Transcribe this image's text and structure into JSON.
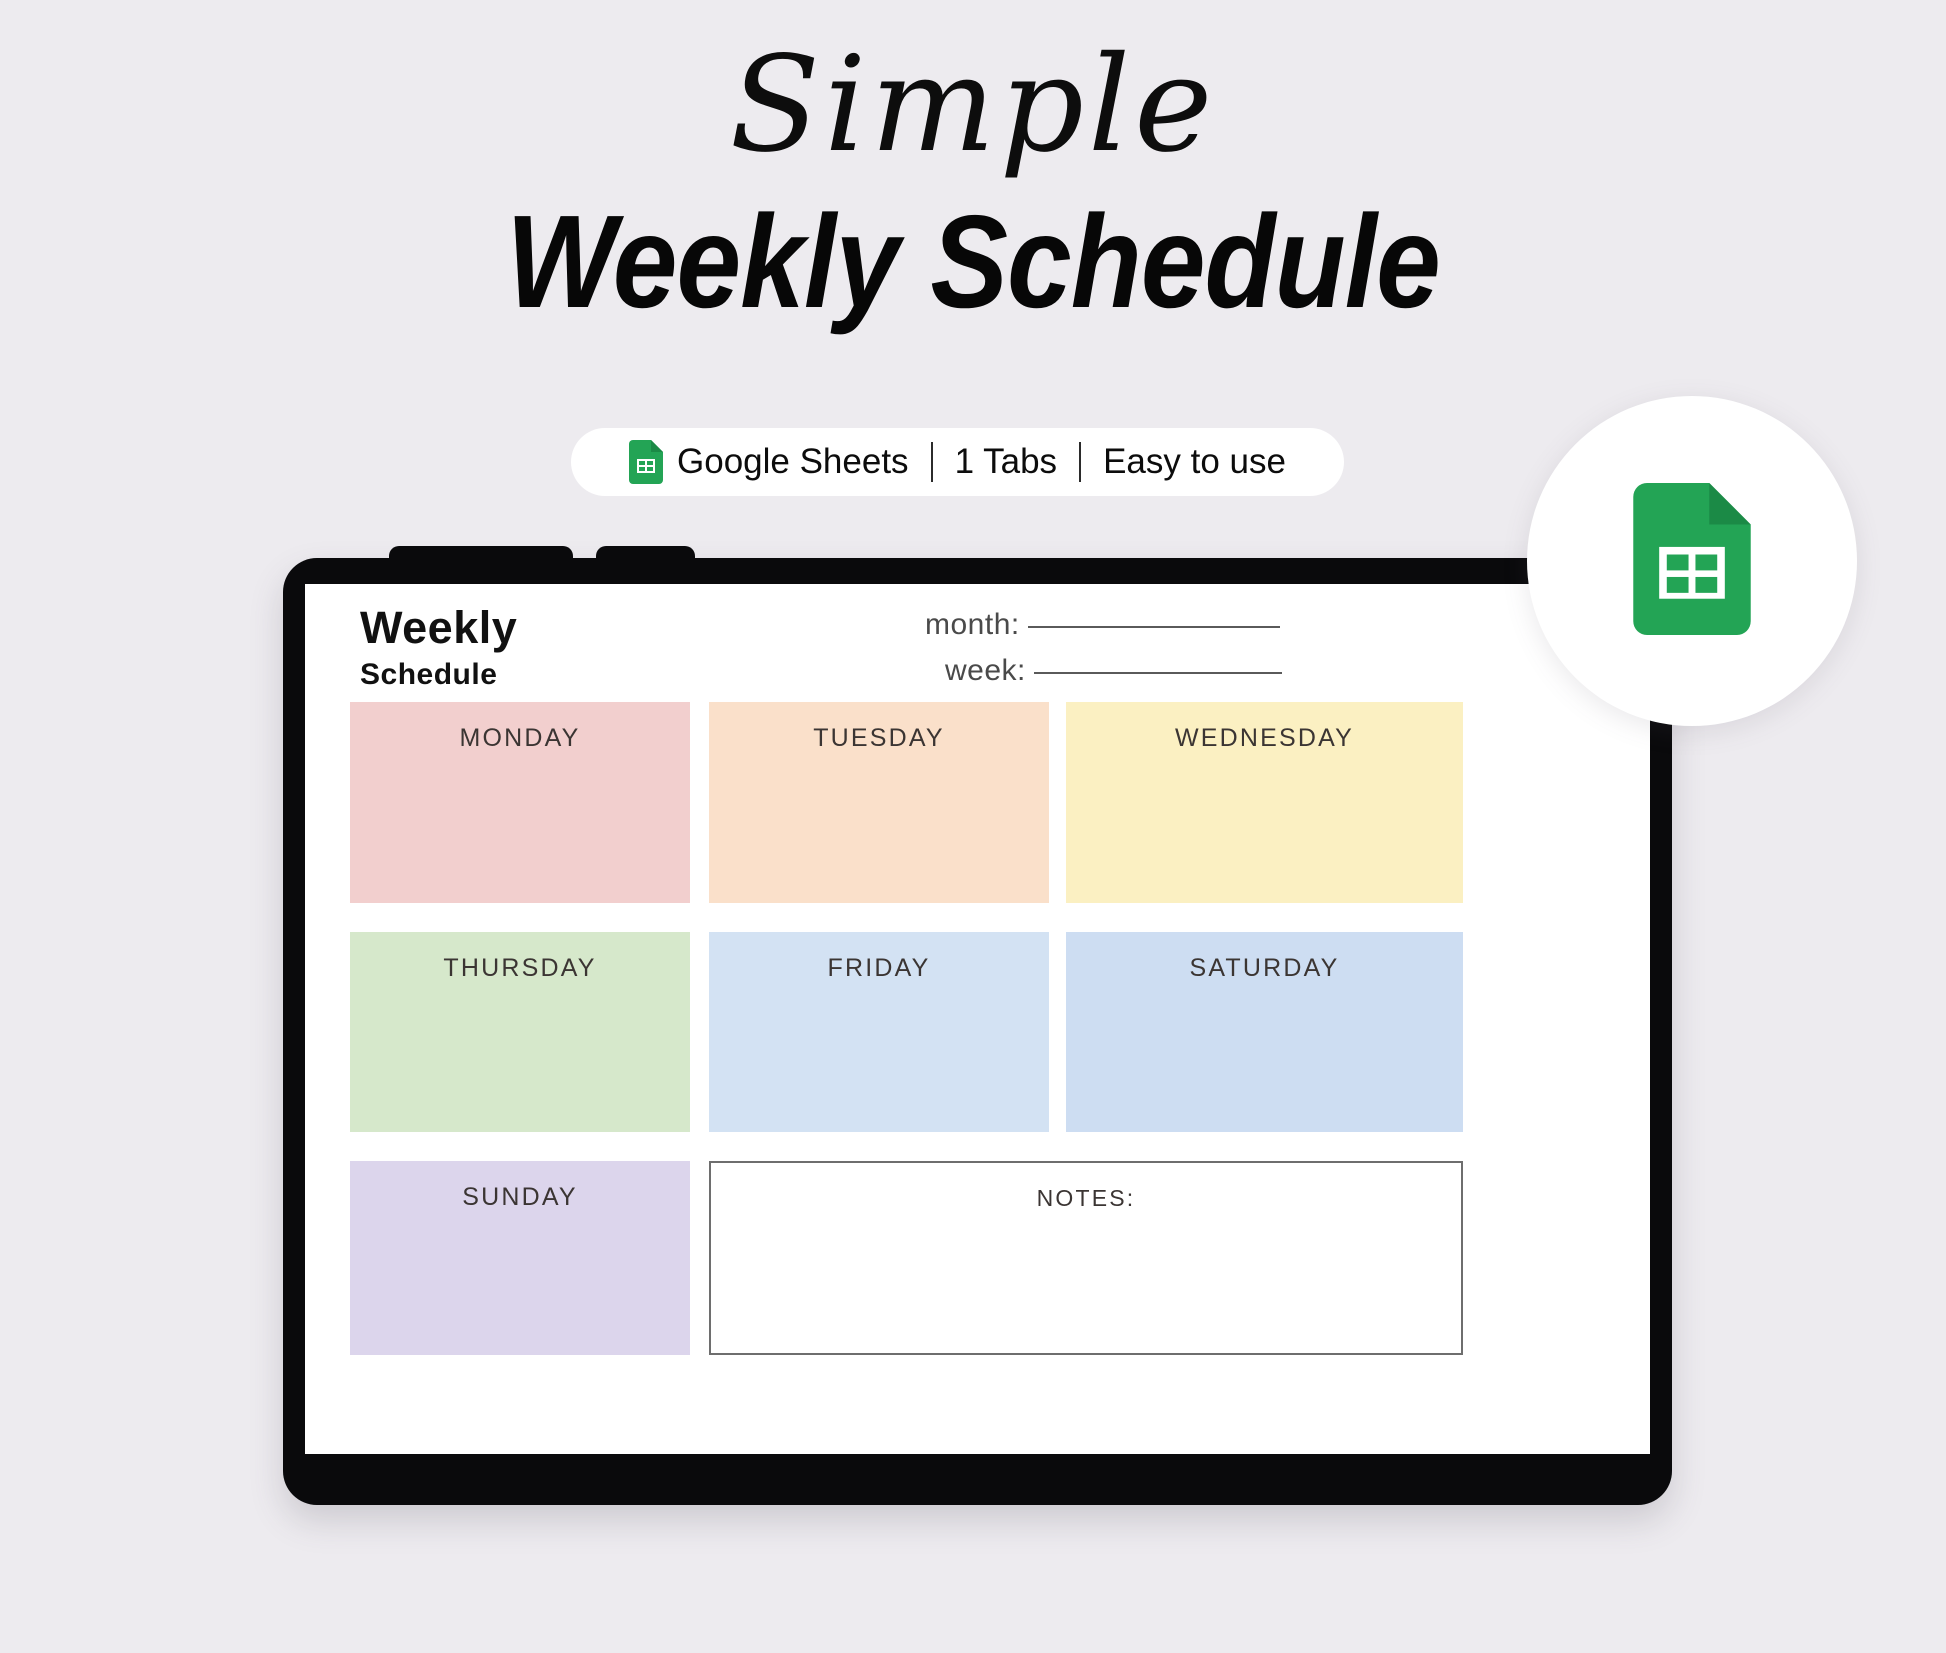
{
  "hero": {
    "script_word": "Simple",
    "headline": "Weekly Schedule"
  },
  "badge": {
    "app_icon": "google-sheets-icon",
    "app_label": "Google Sheets",
    "tabs_label": "1 Tabs",
    "ease_label": "Easy to use",
    "divider": "|"
  },
  "floating_logo": {
    "icon": "google-sheets-icon",
    "green": "#23A455",
    "green_dark": "#1B8A46"
  },
  "sheet": {
    "title": "Weekly",
    "subtitle": "Schedule",
    "fields": [
      {
        "label": "month:",
        "value": ""
      },
      {
        "label": "week:",
        "value": ""
      }
    ],
    "days": [
      {
        "name": "MONDAY",
        "color": "#F2CFCE"
      },
      {
        "name": "TUESDAY",
        "color": "#FAE0CA"
      },
      {
        "name": "WEDNESDAY",
        "color": "#FBF0C2"
      },
      {
        "name": "THURSDAY",
        "color": "#D6E8CB"
      },
      {
        "name": "FRIDAY",
        "color": "#D3E2F3"
      },
      {
        "name": "SATURDAY",
        "color": "#CDDDF2"
      },
      {
        "name": "SUNDAY",
        "color": "#DCD5EC"
      }
    ],
    "notes": {
      "label": "NOTES:",
      "value": ""
    }
  },
  "theme": {
    "page_background": "#EDEBEF",
    "tablet_frame": "#0A0A0C",
    "screen_background": "#FFFFFF",
    "pill_background": "#FFFFFF",
    "text_dark": "#0C0C0C",
    "label_grey": "#3B3533"
  }
}
